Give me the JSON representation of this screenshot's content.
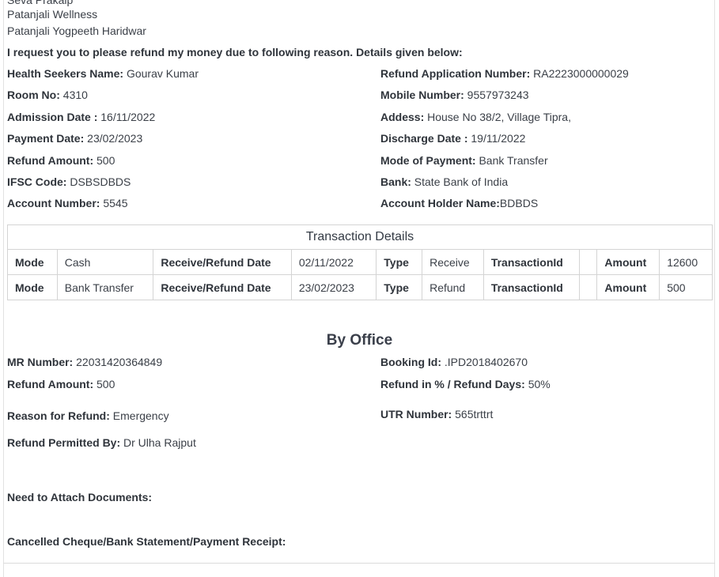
{
  "address": {
    "line0": "Seva Prakalp",
    "line1": "Patanjali Wellness",
    "line2": "Patanjali Yogpeeth Haridwar"
  },
  "request_text": "I request you to please refund my money due to following reason. Details given below:",
  "fields": {
    "health_seeker": {
      "label": "Health Seekers Name:",
      "value": "Gourav Kumar"
    },
    "refund_app_no": {
      "label": "Refund Application Number:",
      "value": "RA2223000000029"
    },
    "room_no": {
      "label": "Room No:",
      "value": "4310"
    },
    "mobile": {
      "label": "Mobile Number:",
      "value": "9557973243"
    },
    "admission_date": {
      "label": "Admission Date :",
      "value": "16/11/2022"
    },
    "address": {
      "label": "Addess:",
      "value": "House No 38/2, Village Tipra,"
    },
    "payment_date": {
      "label": "Payment Date:",
      "value": "23/02/2023"
    },
    "discharge_date": {
      "label": "Discharge Date :",
      "value": "19/11/2022"
    },
    "refund_amount": {
      "label": "Refund Amount:",
      "value": "500"
    },
    "mode_of_payment": {
      "label": "Mode of Payment:",
      "value": "Bank Transfer"
    },
    "ifsc": {
      "label": "IFSC Code:",
      "value": "DSBSDBDS"
    },
    "bank": {
      "label": "Bank:",
      "value": "State Bank of India"
    },
    "account_number": {
      "label": "Account Number:",
      "value": "5545"
    },
    "account_holder": {
      "label": "Account Holder Name:",
      "value": "BDBDS"
    }
  },
  "transactions": {
    "caption": "Transaction Details",
    "labels": {
      "mode": "Mode",
      "date": "Receive/Refund Date",
      "type": "Type",
      "txid": "TransactionId",
      "amount": "Amount"
    },
    "rows": [
      {
        "mode": "Cash",
        "date": "02/11/2022",
        "type": "Receive",
        "txid": "",
        "amount": "12600"
      },
      {
        "mode": "Bank Transfer",
        "date": "23/02/2023",
        "type": "Refund",
        "txid": "",
        "amount": "500"
      }
    ]
  },
  "office": {
    "title": "By Office",
    "mr_number": {
      "label": "MR Number:",
      "value": "22031420364849"
    },
    "booking_id": {
      "label": "Booking Id:",
      "value": ".IPD2018402670"
    },
    "refund_amount": {
      "label": "Refund Amount:",
      "value": "500"
    },
    "refund_percent": {
      "label": "Refund in % / Refund Days:",
      "value": "50%"
    },
    "reason": {
      "label": "Reason for Refund:",
      "value": "Emergency"
    },
    "utr": {
      "label": "UTR Number:",
      "value": "565trttrt"
    },
    "permitted_by": {
      "label": "Refund Permitted By:",
      "value": "Dr Ulha Rajput"
    },
    "attach_docs": "Need to Attach Documents:",
    "cheque": "Cancelled Cheque/Bank Statement/Payment Receipt:"
  }
}
